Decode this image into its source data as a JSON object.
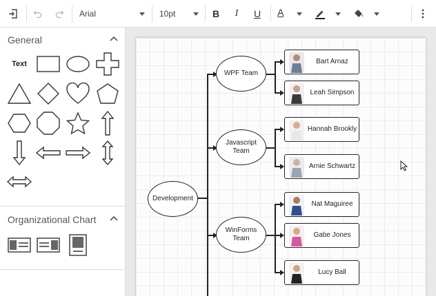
{
  "toolbar": {
    "font_family": "Arial",
    "font_size": "10pt",
    "bold_label": "B",
    "italic_label": "I",
    "underline_label": "U",
    "font_color_label": "A"
  },
  "left_panel": {
    "general_title": "General",
    "text_shape_label": "Text",
    "org_title": "Organizational Chart"
  },
  "diagram": {
    "root": "Development",
    "teams": [
      {
        "label": "WPF Team",
        "members": [
          "Bart Arnaz",
          "Leah Simpson"
        ]
      },
      {
        "label": "Javascript Team",
        "members": [
          "Hannah Brookly",
          "Arnie Schwartz"
        ]
      },
      {
        "label": "WinForms Team",
        "members": [
          "Nat Maguiree",
          "Gabe Jones",
          "Lucy Ball"
        ]
      }
    ]
  },
  "colors": {
    "connector": "#222222",
    "grid": "#ececec",
    "canvas_bg": "#e9e9e9"
  }
}
